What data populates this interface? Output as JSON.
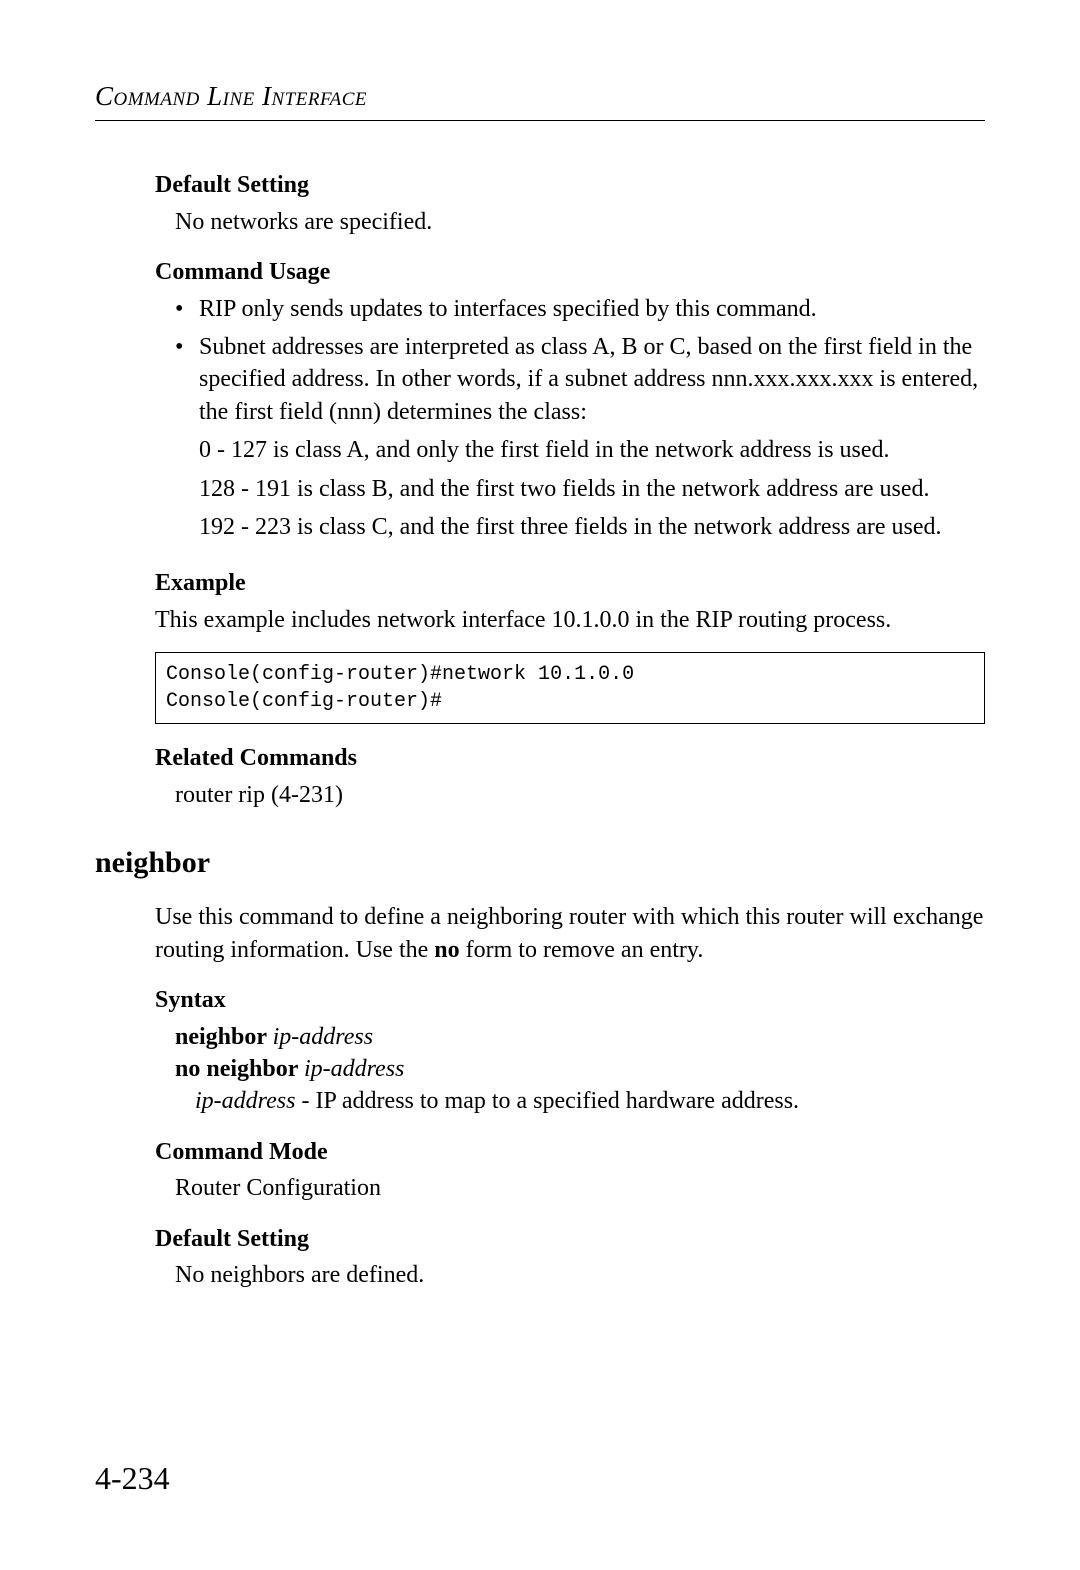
{
  "header": {
    "running_head": "Command Line Interface"
  },
  "section1": {
    "default_setting_head": "Default Setting",
    "default_setting_body": "No networks are specified.",
    "command_usage_head": "Command Usage",
    "bullets": [
      "RIP only sends updates to interfaces specified by this command.",
      "Subnet addresses are interpreted as class A, B or C, based on the first field in the specified address. In other words, if a subnet address nnn.xxx.xxx.xxx is entered, the first field (nnn) determines the class:"
    ],
    "class_lines": [
      "0 - 127 is class A, and only the first field in the network address is used.",
      "128 - 191 is class B, and the first two fields in the network address are used.",
      "192 - 223 is class C, and the first three fields in the network address are used."
    ],
    "example_head": "Example",
    "example_intro": "This example includes network interface 10.1.0.0 in the RIP routing process.",
    "console": "Console(config-router)#network 10.1.0.0\nConsole(config-router)#",
    "related_head": "Related Commands",
    "related_body": "router rip (4-231)"
  },
  "cmd": {
    "title": "neighbor",
    "intro_pre": "Use this command to define a neighboring router with which this router will exchange routing information. Use the ",
    "intro_bold": "no",
    "intro_post": " form to remove an entry.",
    "syntax_head": "Syntax",
    "syntax_line1_bold": "neighbor ",
    "syntax_line1_ital": "ip-address",
    "syntax_line2_bold": "no neighbor ",
    "syntax_line2_ital": "ip-address",
    "syntax_desc_ital": "ip-address",
    "syntax_desc_rest": " - IP address to map to a specified hardware address.",
    "mode_head": "Command Mode",
    "mode_body": "Router Configuration",
    "default_head": "Default Setting",
    "default_body": "No neighbors are defined."
  },
  "page_number": "4-234"
}
